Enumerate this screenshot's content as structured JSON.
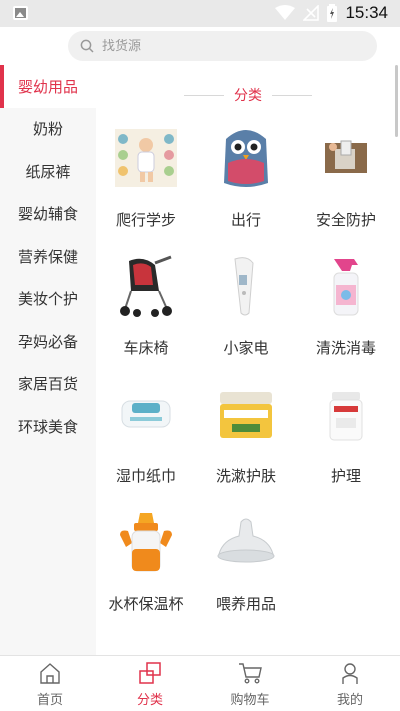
{
  "status_bar": {
    "time": "15:34",
    "icons": [
      "gallery-icon",
      "wifi-icon",
      "no-signal-icon",
      "battery-icon"
    ]
  },
  "search": {
    "placeholder": "找货源",
    "icon": "search-icon"
  },
  "sidebar": {
    "active_index": 0,
    "items": [
      {
        "label": "婴幼用品"
      },
      {
        "label": "奶粉"
      },
      {
        "label": "纸尿裤"
      },
      {
        "label": "婴幼辅食"
      },
      {
        "label": "营养保健"
      },
      {
        "label": "美妆个护"
      },
      {
        "label": "孕妈必备"
      },
      {
        "label": "家居百货"
      },
      {
        "label": "环球美食"
      }
    ]
  },
  "content": {
    "section_title": "分类",
    "categories": [
      {
        "label": "爬行学步",
        "icon": "crawl-mat-icon"
      },
      {
        "label": "出行",
        "icon": "backpack-icon"
      },
      {
        "label": "安全防护",
        "icon": "drawer-lock-icon"
      },
      {
        "label": "车床椅",
        "icon": "stroller-icon"
      },
      {
        "label": "小家电",
        "icon": "thermometer-icon"
      },
      {
        "label": "清洗消毒",
        "icon": "spray-bottle-icon"
      },
      {
        "label": "湿巾纸巾",
        "icon": "wipes-icon"
      },
      {
        "label": "洗漱护肤",
        "icon": "cream-jar-icon"
      },
      {
        "label": "护理",
        "icon": "cotton-swab-icon"
      },
      {
        "label": "水杯保温杯",
        "icon": "sippy-cup-icon"
      },
      {
        "label": "喂养用品",
        "icon": "nipple-icon"
      }
    ]
  },
  "tabbar": {
    "active_index": 1,
    "accent_color": "#e0324b",
    "tabs": [
      {
        "label": "首页",
        "icon": "home-icon"
      },
      {
        "label": "分类",
        "icon": "category-icon"
      },
      {
        "label": "购物车",
        "icon": "cart-icon"
      },
      {
        "label": "我的",
        "icon": "user-icon"
      }
    ]
  }
}
